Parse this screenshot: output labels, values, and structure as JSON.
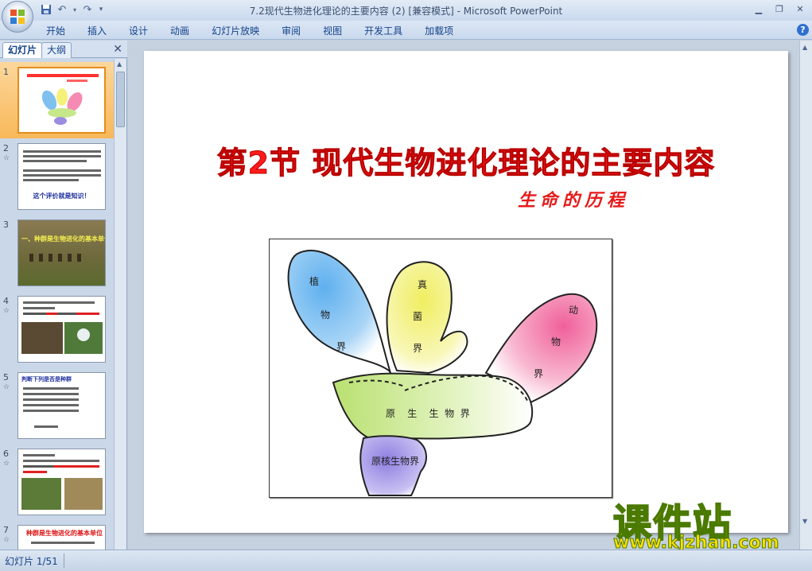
{
  "window": {
    "title": "7.2现代生物进化理论的主要内容 (2) [兼容模式] - Microsoft PowerPoint"
  },
  "ribbon": {
    "tabs": [
      "开始",
      "插入",
      "设计",
      "动画",
      "幻灯片放映",
      "审阅",
      "视图",
      "开发工具",
      "加载项"
    ]
  },
  "pane": {
    "tab_slides": "幻灯片",
    "tab_outline": "大纲",
    "thumbs": [
      {
        "num": "1",
        "star": ""
      },
      {
        "num": "2",
        "star": "☆"
      },
      {
        "num": "3",
        "star": ""
      },
      {
        "num": "4",
        "star": "☆"
      },
      {
        "num": "5",
        "star": "☆"
      },
      {
        "num": "6",
        "star": "☆"
      },
      {
        "num": "7",
        "star": "☆"
      }
    ],
    "thumb2_footer": "这个评价就是知识！",
    "thumb3_caption": "一、种群是生物进化的基本单位",
    "thumb5_title": "判断下列是否是种群",
    "thumb7_title": "种群是生物进化的基本单位"
  },
  "slide": {
    "title": "第2节  现代生物进化理论的主要内容",
    "subtitle": "生命的历程",
    "diagram": {
      "plant": [
        "植",
        "物",
        "界"
      ],
      "fungi": [
        "真",
        "菌",
        "界"
      ],
      "animal": [
        "动",
        "物",
        "界"
      ],
      "protist": "原    生    生  物  界",
      "prokaryote": "原核生物界"
    }
  },
  "watermark": {
    "main": "课件站",
    "url": "www.kjzhan.com"
  },
  "status": {
    "slide_info": "幻灯片 1/51"
  },
  "colors": {
    "title_red": "#ff1b1b",
    "plant_blue": "#6fb6ee",
    "fungi_yellow": "#f3f07a",
    "animal_pink": "#f37aa8",
    "protist_green": "#c6e88a",
    "prokaryote_purple": "#9b8de0"
  }
}
